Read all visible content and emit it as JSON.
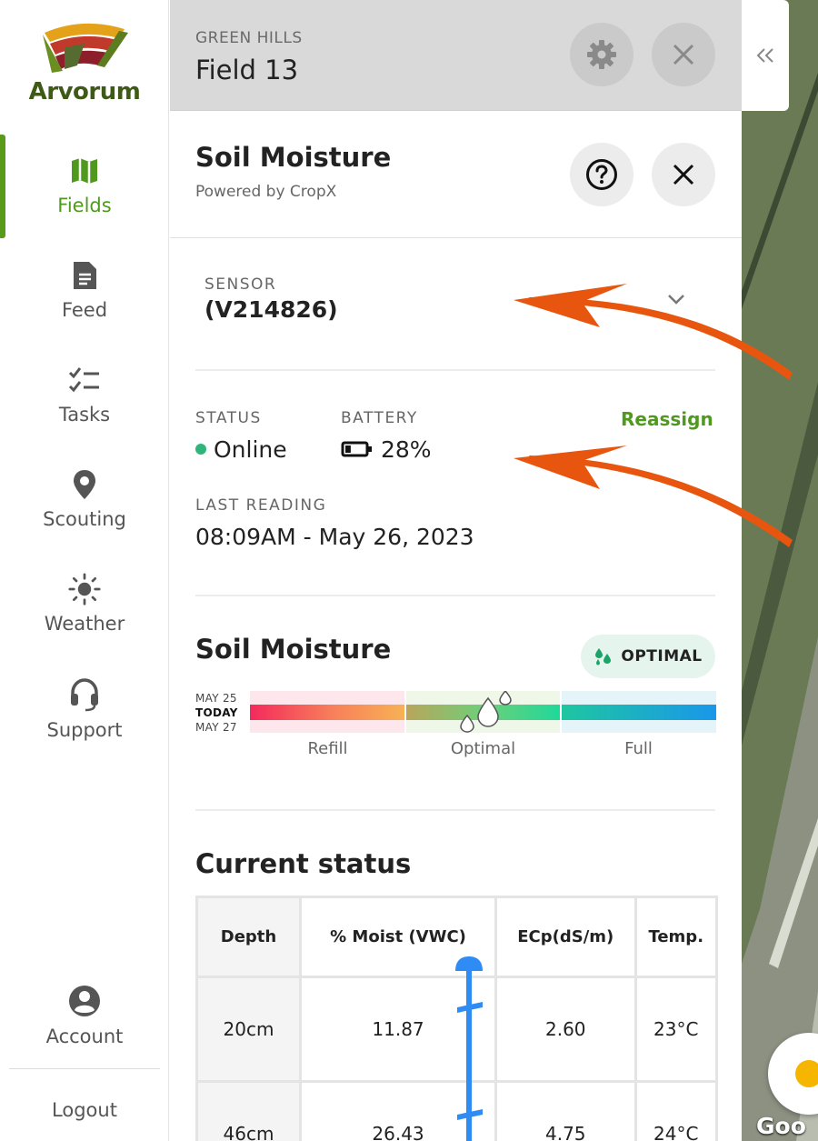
{
  "brand": {
    "name": "Arvorum"
  },
  "sidebar": {
    "items": [
      {
        "label": "Fields",
        "icon": "map-icon",
        "active": true
      },
      {
        "label": "Feed",
        "icon": "document-icon"
      },
      {
        "label": "Tasks",
        "icon": "checklist-icon"
      },
      {
        "label": "Scouting",
        "icon": "location-pin-icon"
      },
      {
        "label": "Weather",
        "icon": "sun-icon"
      },
      {
        "label": "Support",
        "icon": "headset-icon"
      }
    ],
    "account_label": "Account",
    "logout_label": "Logout"
  },
  "topbar": {
    "farm": "GREEN HILLS",
    "field": "Field 13"
  },
  "header": {
    "title": "Soil Moisture",
    "subtitle": "Powered by CropX"
  },
  "sensor": {
    "label": "SENSOR",
    "value": "(V214826)"
  },
  "status": {
    "status_label": "STATUS",
    "status_value": "Online",
    "battery_label": "BATTERY",
    "battery_value": "28%",
    "battery_level": 0.28,
    "reassign_label": "Reassign",
    "last_reading_label": "LAST READING",
    "last_reading_value": "08:09AM - May 26, 2023"
  },
  "soil_moisture": {
    "title": "Soil Moisture",
    "badge": "OPTIMAL",
    "dates": [
      "MAY 25",
      "TODAY",
      "MAY 27"
    ],
    "zones": [
      "Refill",
      "Optimal",
      "Full"
    ]
  },
  "current_status": {
    "title": "Current status",
    "headers": [
      "Depth",
      "% Moist (VWC)",
      "ECp(dS/m)",
      "Temp."
    ],
    "rows": [
      [
        "20cm",
        "11.87",
        "2.60",
        "23°C"
      ],
      [
        "46cm",
        "26.43",
        "4.75",
        "24°C"
      ]
    ]
  },
  "map": {
    "attribution": "Goo"
  },
  "colors": {
    "accent": "#4f9a1e",
    "online": "#2fb57a",
    "annotation": "#e8550f",
    "timeline": "#2f8cf5"
  }
}
